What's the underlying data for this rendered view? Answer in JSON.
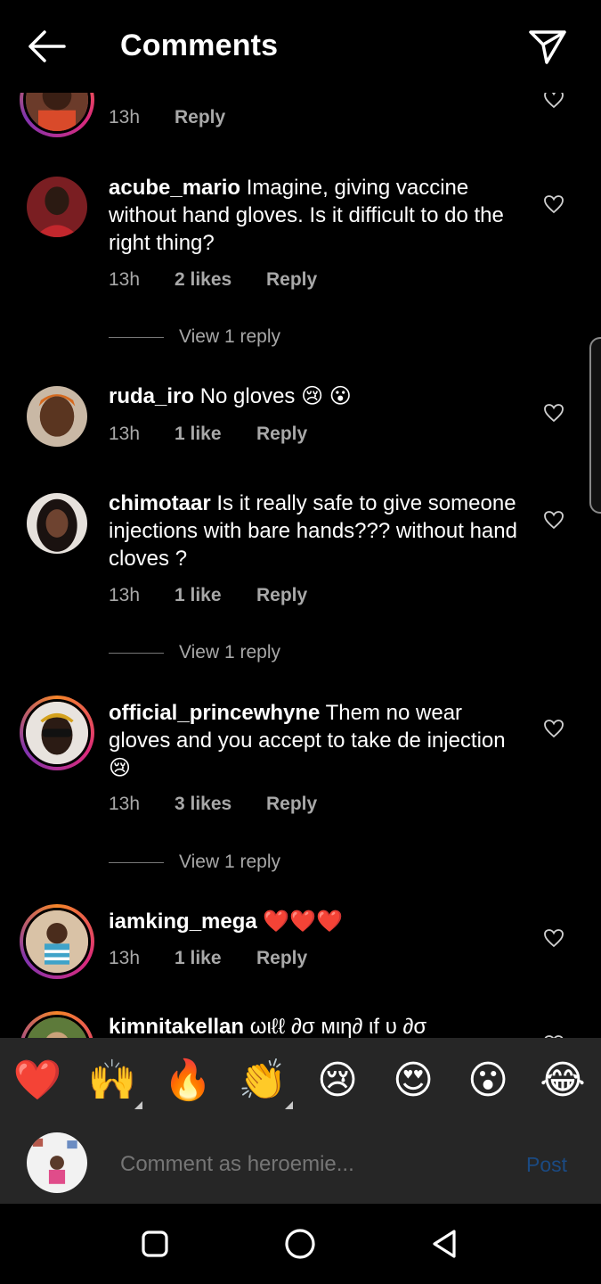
{
  "header": {
    "title": "Comments"
  },
  "comments": [
    {
      "user": "",
      "text": "",
      "time": "13h",
      "likes": "",
      "reply": "Reply",
      "view_reply": ""
    },
    {
      "user": "acube_mario",
      "text": " Imagine, giving vaccine without hand gloves. Is it difficult to do the right thing?",
      "time": "13h",
      "likes": "2 likes",
      "reply": "Reply",
      "view_reply": "View 1 reply"
    },
    {
      "user": "ruda_iro",
      "text": " No gloves 😢 😮",
      "time": "13h",
      "likes": "1 like",
      "reply": "Reply",
      "view_reply": ""
    },
    {
      "user": "chimotaar",
      "text": " Is it really safe to give someone injections with bare hands??? without hand cloves ?",
      "time": "13h",
      "likes": "1 like",
      "reply": "Reply",
      "view_reply": "View 1 reply"
    },
    {
      "user": "official_princewhyne",
      "text": " Them no wear gloves and you accept to take de injection😢",
      "time": "13h",
      "likes": "3 likes",
      "reply": "Reply",
      "view_reply": "View 1 reply"
    },
    {
      "user": "iamking_mega",
      "text": " ❤️❤️❤️",
      "time": "13h",
      "likes": "1 like",
      "reply": "Reply",
      "view_reply": ""
    },
    {
      "user": "kimnitakellan",
      "text": " ωιℓℓ ∂σ мιη∂ ιf υ ∂σ",
      "time": "",
      "likes": "",
      "reply": "",
      "view_reply": ""
    }
  ],
  "quick_emojis": [
    "❤️",
    "🙌",
    "🔥",
    "👏",
    "😢",
    "😍",
    "😮",
    "😂"
  ],
  "composer": {
    "placeholder": "Comment as heroemie...",
    "post_label": "Post"
  },
  "icons": {
    "back": "arrow-left-icon",
    "send": "paper-plane-icon",
    "like": "heart-outline-icon",
    "nav": [
      "square-recents-icon",
      "circle-home-icon",
      "triangle-back-icon"
    ]
  },
  "colors": {
    "background": "#000000",
    "meta_text": "#a8a8a8",
    "panel": "#262626",
    "post_disabled": "#1b4a82"
  }
}
